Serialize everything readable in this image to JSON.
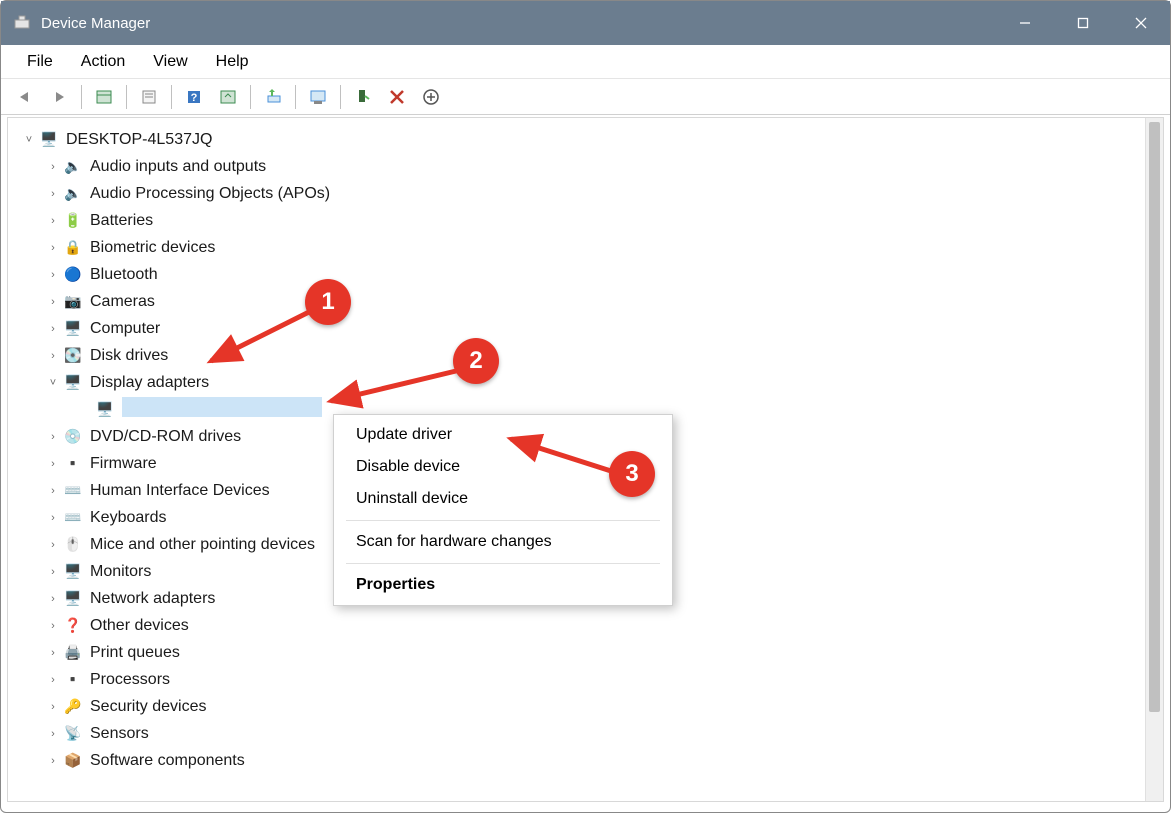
{
  "window": {
    "title": "Device Manager",
    "buttons": {
      "min": "—",
      "max": "▢",
      "close": "✕"
    }
  },
  "menubar": [
    "File",
    "Action",
    "View",
    "Help"
  ],
  "toolbar": [
    {
      "name": "back-icon",
      "glyph": "◄"
    },
    {
      "name": "forward-icon",
      "glyph": "►"
    },
    {
      "name": "sep"
    },
    {
      "name": "show-hide-tree-icon",
      "glyph": "▦"
    },
    {
      "name": "sep"
    },
    {
      "name": "properties-icon",
      "glyph": "▤"
    },
    {
      "name": "sep"
    },
    {
      "name": "help-icon",
      "glyph": "?"
    },
    {
      "name": "scan-hardware-icon",
      "glyph": "▦"
    },
    {
      "name": "sep"
    },
    {
      "name": "update-driver-icon",
      "glyph": "⬆"
    },
    {
      "name": "sep"
    },
    {
      "name": "uninstall-icon",
      "glyph": "▭"
    },
    {
      "name": "sep"
    },
    {
      "name": "enable-device-icon",
      "glyph": "▮"
    },
    {
      "name": "disable-device-icon",
      "glyph": "✖"
    },
    {
      "name": "scan-for-changes-icon",
      "glyph": "⊕"
    }
  ],
  "tree": {
    "root": {
      "label": "DESKTOP-4L537JQ",
      "chev": "˅"
    },
    "categories": [
      {
        "label": "Audio inputs and outputs",
        "icon": "speaker-icon",
        "chev": "›"
      },
      {
        "label": "Audio Processing Objects (APOs)",
        "icon": "speaker-icon",
        "chev": "›"
      },
      {
        "label": "Batteries",
        "icon": "battery-icon",
        "chev": "›"
      },
      {
        "label": "Biometric devices",
        "icon": "fingerprint-icon",
        "chev": "›"
      },
      {
        "label": "Bluetooth",
        "icon": "bluetooth-icon",
        "chev": "›"
      },
      {
        "label": "Cameras",
        "icon": "camera-icon",
        "chev": "›"
      },
      {
        "label": "Computer",
        "icon": "computer-icon",
        "chev": "›"
      },
      {
        "label": "Disk drives",
        "icon": "disk-icon",
        "chev": "›"
      },
      {
        "label": "Display adapters",
        "icon": "display-icon",
        "chev": "˅",
        "expanded": true,
        "children": [
          {
            "label": "",
            "icon": "display-icon",
            "selected": true
          }
        ]
      },
      {
        "label": "DVD/CD-ROM drives",
        "icon": "optical-icon",
        "chev": "›"
      },
      {
        "label": "Firmware",
        "icon": "chip-icon",
        "chev": "›"
      },
      {
        "label": "Human Interface Devices",
        "icon": "hid-icon",
        "chev": "›"
      },
      {
        "label": "Keyboards",
        "icon": "keyboard-icon",
        "chev": "›"
      },
      {
        "label": "Mice and other pointing devices",
        "icon": "mouse-icon",
        "chev": "›"
      },
      {
        "label": "Monitors",
        "icon": "monitor-icon",
        "chev": "›"
      },
      {
        "label": "Network adapters",
        "icon": "network-icon",
        "chev": "›"
      },
      {
        "label": "Other devices",
        "icon": "other-icon",
        "chev": "›"
      },
      {
        "label": "Print queues",
        "icon": "printer-icon",
        "chev": "›"
      },
      {
        "label": "Processors",
        "icon": "cpu-icon",
        "chev": "›"
      },
      {
        "label": "Security devices",
        "icon": "security-icon",
        "chev": "›"
      },
      {
        "label": "Sensors",
        "icon": "sensor-icon",
        "chev": "›"
      },
      {
        "label": "Software components",
        "icon": "software-icon",
        "chev": "›"
      }
    ]
  },
  "context_menu": {
    "items": [
      {
        "label": "Update driver"
      },
      {
        "label": "Disable device"
      },
      {
        "label": "Uninstall device"
      },
      {
        "sep": true
      },
      {
        "label": "Scan for hardware changes"
      },
      {
        "sep": true
      },
      {
        "label": "Properties",
        "bold": true
      }
    ]
  },
  "annotations": {
    "1": "1",
    "2": "2",
    "3": "3"
  },
  "device_icons": {
    "computer-root-icon": "🖥️",
    "speaker-icon": "🔈",
    "battery-icon": "🔋",
    "fingerprint-icon": "🔒",
    "bluetooth-icon": "🔵",
    "camera-icon": "📷",
    "computer-icon": "🖥️",
    "disk-icon": "💽",
    "display-icon": "🖥️",
    "optical-icon": "💿",
    "chip-icon": "▪️",
    "hid-icon": "⌨️",
    "keyboard-icon": "⌨️",
    "mouse-icon": "🖱️",
    "monitor-icon": "🖥️",
    "network-icon": "🖥️",
    "other-icon": "❓",
    "printer-icon": "🖨️",
    "cpu-icon": "▪️",
    "security-icon": "🔑",
    "sensor-icon": "📡",
    "software-icon": "📦"
  }
}
